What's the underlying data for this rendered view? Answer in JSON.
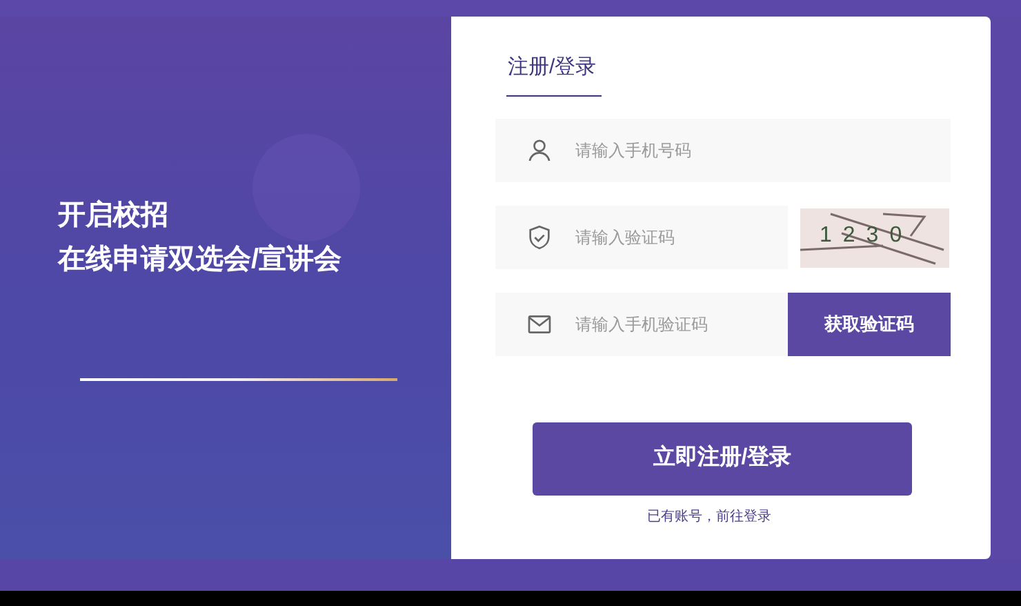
{
  "promo": {
    "lines": [
      "开启校招",
      "在线申请双选会/宣讲会"
    ]
  },
  "tabs": [
    {
      "label": "注册/登录",
      "selected": true
    }
  ],
  "fields": [
    {
      "kind": "phone",
      "placeholder": "请输入手机号码"
    },
    {
      "kind": "captcha",
      "placeholder": "请输入验证码",
      "code": "1230"
    },
    {
      "kind": "sms",
      "placeholder": "请输入手机验证码",
      "button": "获取验证码"
    }
  ],
  "submit": "立即注册/登录",
  "login_link": "已有账号，前往登录"
}
